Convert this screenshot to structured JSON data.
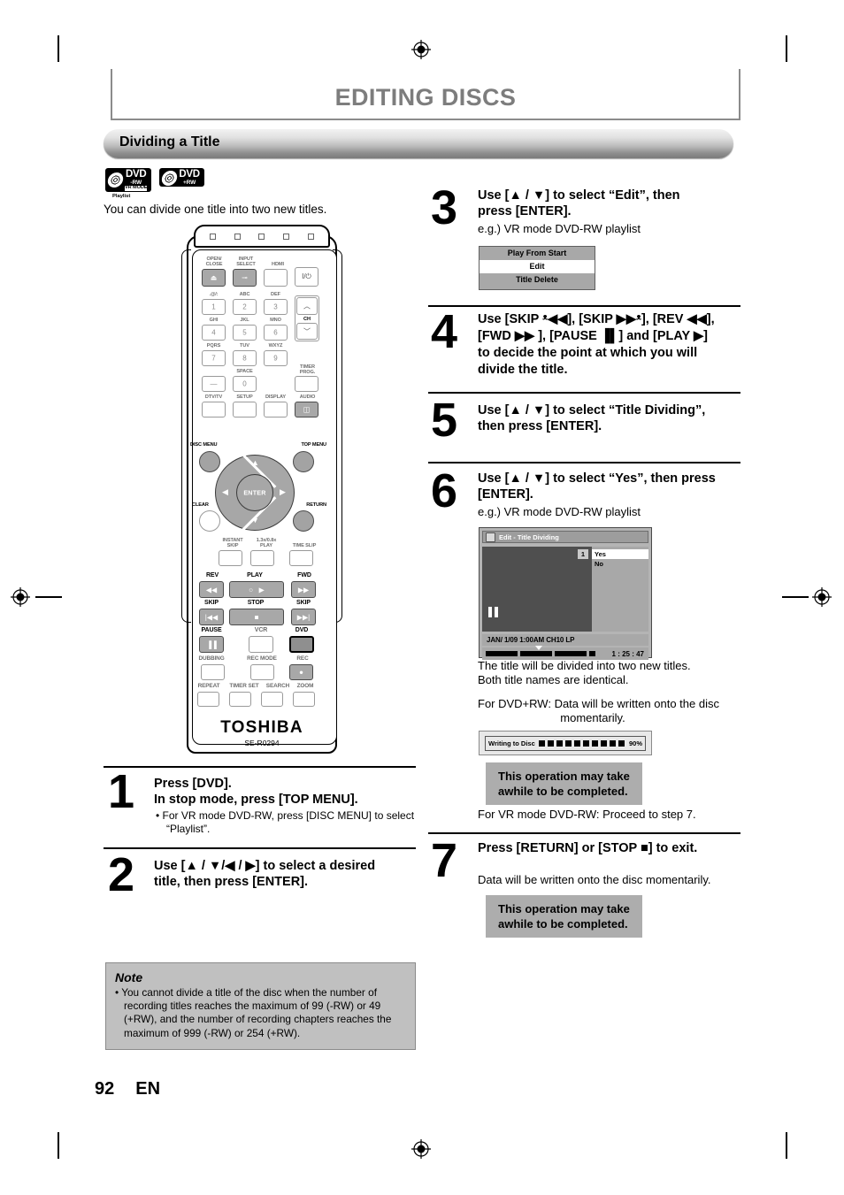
{
  "page": {
    "title": "EDITING DISCS",
    "section": "Dividing a Title",
    "intro": "You can divide one title into two new titles.",
    "footer_number": "92",
    "footer_lang": "EN"
  },
  "disc_logos": [
    {
      "name": "dvd-rw-vr-mode-playlist",
      "line1": "DVD",
      "line2": "-RW",
      "line3": "VR MODE",
      "line4": "Playlist"
    },
    {
      "name": "dvd-plus-rw",
      "line1": "DVD",
      "line2": "+RW",
      "line3": "",
      "line4": ""
    }
  ],
  "remote": {
    "brand": "TOSHIBA",
    "model": "SE-R0294",
    "labels": {
      "open_close": "OPEN/\nCLOSE",
      "input_select": "INPUT\nSELECT",
      "hdmi": "HDMI",
      "power": "I/⏻",
      "key1_abc": ".@/:",
      "key2_abc": "ABC",
      "key3_abc": "DEF",
      "key4_abc": "GHI",
      "key5_abc": "JKL",
      "key6_abc": "MNO",
      "key7_abc": "PQRS",
      "key8_abc": "TUV",
      "key9_abc": "WXYZ",
      "space": "SPACE",
      "ch": "CH",
      "timer_prog": "TIMER\nPROG.",
      "dtv_tv": "DTV/TV",
      "setup": "SETUP",
      "display": "DISPLAY",
      "audio": "AUDIO",
      "disc_menu": "DISC MENU",
      "top_menu": "TOP MENU",
      "enter": "ENTER",
      "clear": "CLEAR",
      "return": "RETURN",
      "instant_skip": "INSTANT\nSKIP",
      "speed_play": "1.3x/0.8x\nPLAY",
      "time_slip": "TIME SLIP",
      "rev": "REV",
      "play": "PLAY",
      "fwd": "FWD",
      "skip_back": "SKIP",
      "stop": "STOP",
      "skip_fwd": "SKIP",
      "pause": "PAUSE",
      "vcr": "VCR",
      "dvd": "DVD",
      "dubbing": "DUBBING",
      "rec_mode": "REC MODE",
      "rec": "REC",
      "repeat": "REPEAT",
      "timer_set": "TIMER SET",
      "search": "SEARCH",
      "zoom": "ZOOM"
    },
    "keys": {
      "n1": "1",
      "n2": "2",
      "n3": "3",
      "n4": "4",
      "n5": "5",
      "n6": "6",
      "n7": "7",
      "n8": "8",
      "n9": "9",
      "n0": "0",
      "dash": "—"
    }
  },
  "steps": [
    {
      "num": "1",
      "head_lines": [
        "Press [DVD].",
        "In stop mode, press [TOP MENU]."
      ],
      "bullet": "• For VR mode DVD-RW, press [DISC MENU] to select “Playlist”."
    },
    {
      "num": "2",
      "head_lines": [
        "Use [▲ / ▼/◀ / ▶] to select a desired",
        "title, then press [ENTER]."
      ]
    },
    {
      "num": "3",
      "head_lines": [
        "Use [▲ / ▼] to select “Edit”, then",
        "press [ENTER]."
      ],
      "sub": "e.g.) VR mode DVD-RW playlist"
    },
    {
      "num": "4",
      "head_lines": [
        "Use [SKIP ᵜ◀◀], [SKIP ▶▶ᵜ], [REV ◀◀],",
        "[FWD ▶▶ ], [PAUSE ▐▌] and [PLAY ▶]",
        "to decide the point at which you will",
        "divide the title."
      ]
    },
    {
      "num": "5",
      "head_lines": [
        "Use [▲ / ▼] to select “Title Dividing”,",
        "then press [ENTER]."
      ]
    },
    {
      "num": "6",
      "head_lines": [
        "Use [▲ / ▼] to select “Yes”, then press",
        "[ENTER]."
      ],
      "sub": "e.g.) VR mode DVD-RW playlist",
      "after_lines": [
        "The title will be divided into two new titles.",
        "Both title names are identical."
      ],
      "plus_rw_lines": [
        "For DVD+RW: Data will be written onto the disc",
        "momentarily."
      ],
      "callout": [
        "This operation may take",
        "awhile to be completed."
      ],
      "vr_line": "For VR mode DVD-RW: Proceed to step 7."
    },
    {
      "num": "7",
      "head_lines": [
        "Press [RETURN] or [STOP ■] to exit."
      ],
      "sub": "Data will be written onto the disc momentarily.",
      "callout": [
        "This operation may take",
        "awhile to be completed."
      ]
    }
  ],
  "osd_menu": {
    "items": [
      "Play From Start",
      "Edit",
      "Title Delete"
    ],
    "selected": "Edit"
  },
  "osd_screen": {
    "header": "Edit - Title Dividing",
    "chapter_badge": "1",
    "options": [
      "Yes",
      "No"
    ],
    "selected": "Yes",
    "info": "JAN/ 1/09 1:00AM CH10   LP",
    "time": "1 : 25 : 47"
  },
  "writing_dialog": {
    "label": "Writing to Disc",
    "percent": "90%"
  },
  "note": {
    "title": "Note",
    "body": "• You cannot divide a title of the disc when the number of recording titles reaches the maximum of 99 (-RW) or 49 (+RW), and the number of recording chapters reaches the maximum of 999 (-RW) or 254 (+RW)."
  }
}
